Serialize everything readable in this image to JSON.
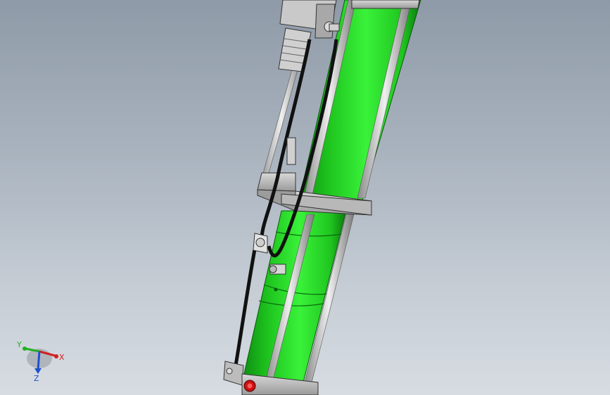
{
  "view": {
    "background_top": "#8f9aa8",
    "background_bottom": "#d7dce2"
  },
  "model": {
    "body_color": "#27e12a",
    "body_dark": "#0e8f12",
    "bracket_color": "#bcbcbc",
    "rod_color": "#c8c8c8",
    "hose_color": "#111111",
    "port_color": "#cc1111"
  },
  "triad": {
    "x_label": "X",
    "y_label": "Y",
    "z_label": "Z",
    "x_color": "#d42020",
    "y_color": "#20b020",
    "z_color": "#2050d0"
  }
}
